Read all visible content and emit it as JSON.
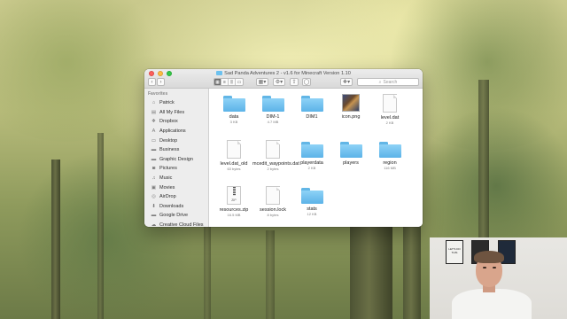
{
  "window": {
    "title": "Sad Panda Adventures 2 - v1.6 for Minecraft Version 1.10",
    "search_placeholder": "Search"
  },
  "sidebar": {
    "header": "Favorites",
    "items": [
      {
        "label": "Patrick",
        "icon": "home-icon"
      },
      {
        "label": "All My Files",
        "icon": "files-icon"
      },
      {
        "label": "Dropbox",
        "icon": "dropbox-icon"
      },
      {
        "label": "Applications",
        "icon": "applications-icon"
      },
      {
        "label": "Desktop",
        "icon": "desktop-icon"
      },
      {
        "label": "Business",
        "icon": "folder-icon"
      },
      {
        "label": "Graphic Design",
        "icon": "folder-icon"
      },
      {
        "label": "Pictures",
        "icon": "camera-icon"
      },
      {
        "label": "Music",
        "icon": "music-icon"
      },
      {
        "label": "Movies",
        "icon": "film-icon"
      },
      {
        "label": "AirDrop",
        "icon": "airdrop-icon"
      },
      {
        "label": "Downloads",
        "icon": "downloads-icon"
      },
      {
        "label": "Google Drive",
        "icon": "folder-icon"
      },
      {
        "label": "Creative Cloud Files",
        "icon": "cloud-icon"
      }
    ]
  },
  "files": [
    {
      "name": "data",
      "size": "3 KB",
      "kind": "folder"
    },
    {
      "name": "DIM-1",
      "size": "4.7 MB",
      "kind": "folder"
    },
    {
      "name": "DIM1",
      "size": "",
      "kind": "folder"
    },
    {
      "name": "icon.png",
      "size": "",
      "kind": "image"
    },
    {
      "name": "level.dat",
      "size": "2 KB",
      "kind": "document"
    },
    {
      "name": "level.dat_old",
      "size": "63 bytes",
      "kind": "document"
    },
    {
      "name": "mcedit_waypoints.dat",
      "size": "2 bytes",
      "kind": "document"
    },
    {
      "name": "playerdata",
      "size": "2 KB",
      "kind": "folder"
    },
    {
      "name": "players",
      "size": "",
      "kind": "folder"
    },
    {
      "name": "region",
      "size": "116 MB",
      "kind": "folder"
    },
    {
      "name": "resources.zip",
      "size": "16.5 MB",
      "kind": "zip"
    },
    {
      "name": "session.lock",
      "size": "8 bytes",
      "kind": "document"
    },
    {
      "name": "stats",
      "size": "12 KB",
      "kind": "folder"
    }
  ],
  "webcam": {
    "poster_text": "LET'S DO THIS"
  },
  "colors": {
    "folder_blue": "#6cc1ef",
    "close_red": "#fc605c",
    "minimize_yellow": "#fdbc40",
    "zoom_green": "#34c84a"
  }
}
